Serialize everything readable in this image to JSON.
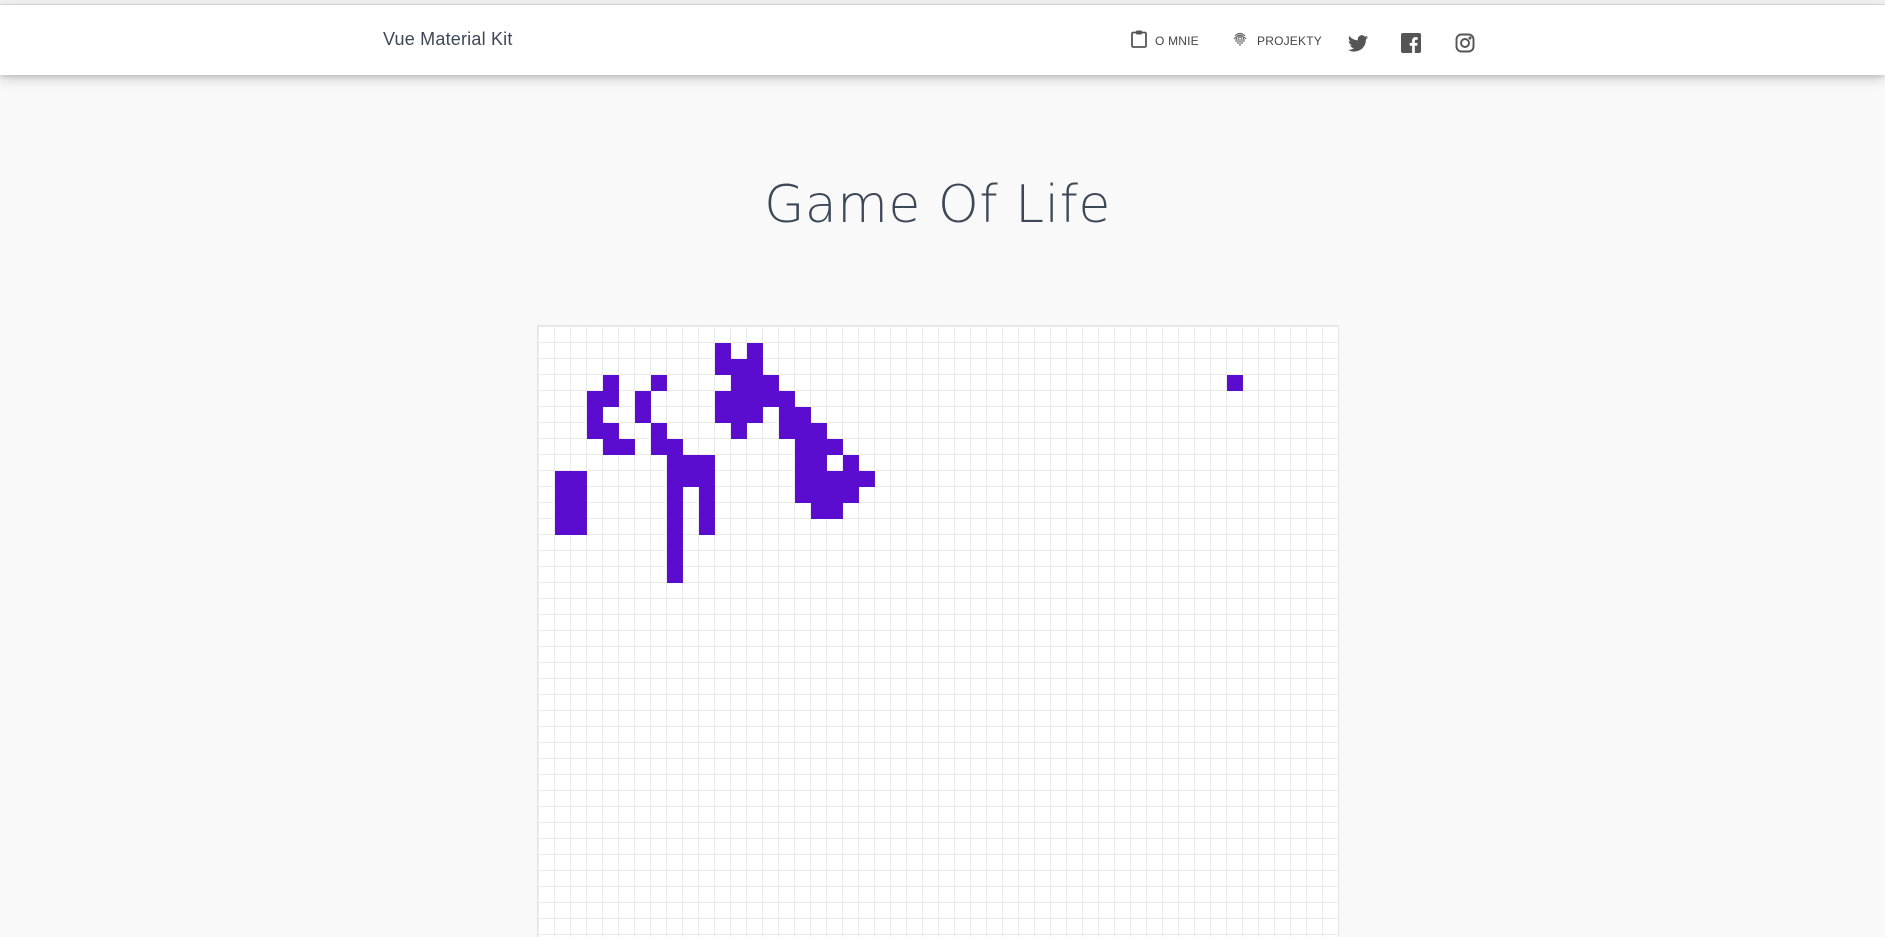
{
  "navbar": {
    "brand": "Vue Material Kit",
    "items": [
      {
        "label": "O MNIE",
        "icon": "clipboard-icon"
      },
      {
        "label": "PROJEKTY",
        "icon": "fingerprint-icon"
      }
    ],
    "social": [
      "twitter-icon",
      "facebook-icon",
      "instagram-icon"
    ]
  },
  "page": {
    "title": "Game Of Life"
  },
  "board": {
    "columns": 50,
    "visible_rows": 38,
    "live_color": "#5a0ccf",
    "grid_color": "#ebebeb",
    "live_cells": [
      [
        3,
        43
      ],
      [
        9,
        1
      ],
      [
        10,
        1
      ],
      [
        11,
        1
      ],
      [
        12,
        1
      ],
      [
        9,
        2
      ],
      [
        10,
        2
      ],
      [
        11,
        2
      ],
      [
        12,
        2
      ],
      [
        4,
        3
      ],
      [
        5,
        3
      ],
      [
        6,
        3
      ],
      [
        3,
        4
      ],
      [
        4,
        4
      ],
      [
        6,
        4
      ],
      [
        7,
        4
      ],
      [
        7,
        5
      ],
      [
        4,
        6
      ],
      [
        5,
        6
      ],
      [
        3,
        7
      ],
      [
        6,
        7
      ],
      [
        7,
        7
      ],
      [
        7,
        8
      ],
      [
        8,
        8
      ],
      [
        9,
        8
      ],
      [
        10,
        8
      ],
      [
        11,
        8
      ],
      [
        12,
        8
      ],
      [
        13,
        8
      ],
      [
        14,
        8
      ],
      [
        15,
        8
      ],
      [
        8,
        9
      ],
      [
        9,
        9
      ],
      [
        8,
        10
      ],
      [
        9,
        10
      ],
      [
        10,
        10
      ],
      [
        11,
        10
      ],
      [
        12,
        10
      ],
      [
        1,
        11
      ],
      [
        2,
        11
      ],
      [
        4,
        11
      ],
      [
        5,
        11
      ],
      [
        2,
        12
      ],
      [
        3,
        12
      ],
      [
        4,
        12
      ],
      [
        5,
        12
      ],
      [
        6,
        12
      ],
      [
        1,
        13
      ],
      [
        2,
        13
      ],
      [
        3,
        13
      ],
      [
        4,
        13
      ],
      [
        5,
        13
      ],
      [
        3,
        14
      ],
      [
        4,
        14
      ],
      [
        4,
        15
      ],
      [
        5,
        15
      ],
      [
        6,
        15
      ],
      [
        5,
        16
      ],
      [
        6,
        16
      ],
      [
        7,
        16
      ],
      [
        8,
        16
      ],
      [
        9,
        16
      ],
      [
        10,
        16
      ],
      [
        6,
        17
      ],
      [
        7,
        17
      ],
      [
        8,
        17
      ],
      [
        9,
        17
      ],
      [
        10,
        17
      ],
      [
        11,
        17
      ],
      [
        7,
        18
      ],
      [
        9,
        18
      ],
      [
        10,
        18
      ],
      [
        11,
        18
      ],
      [
        8,
        19
      ],
      [
        9,
        19
      ],
      [
        10,
        19
      ],
      [
        9,
        20
      ]
    ]
  }
}
